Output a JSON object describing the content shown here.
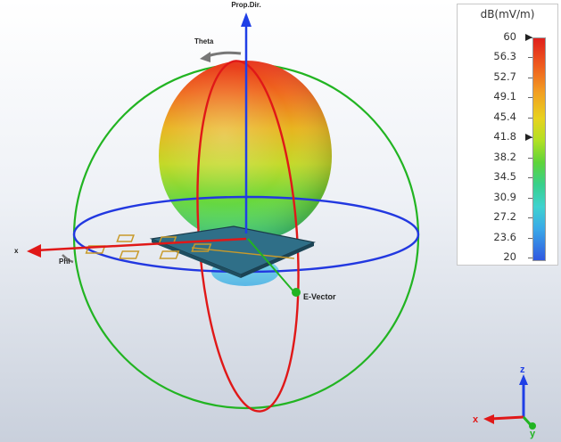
{
  "scene": {
    "prop_dir_label": "Prop.Dir.",
    "theta_label": "Theta",
    "phi_label": "Phi",
    "x_label": "x",
    "e_vector_label": "E-Vector"
  },
  "legend": {
    "title": "dB(mV/m)",
    "ticks": [
      "60",
      "56.3",
      "52.7",
      "49.1",
      "45.4",
      "41.8",
      "38.2",
      "34.5",
      "30.9",
      "27.2",
      "23.6",
      "20"
    ],
    "markers": [
      "60",
      "41.8"
    ]
  },
  "axes_triad": {
    "x": "x",
    "y": "y",
    "z": "z"
  },
  "colors": {
    "ring_green": "#22b422",
    "ring_blue": "#2238e0",
    "ring_red": "#e01818",
    "axis_blue": "#1f3fe6",
    "axis_red": "#e01818"
  }
}
